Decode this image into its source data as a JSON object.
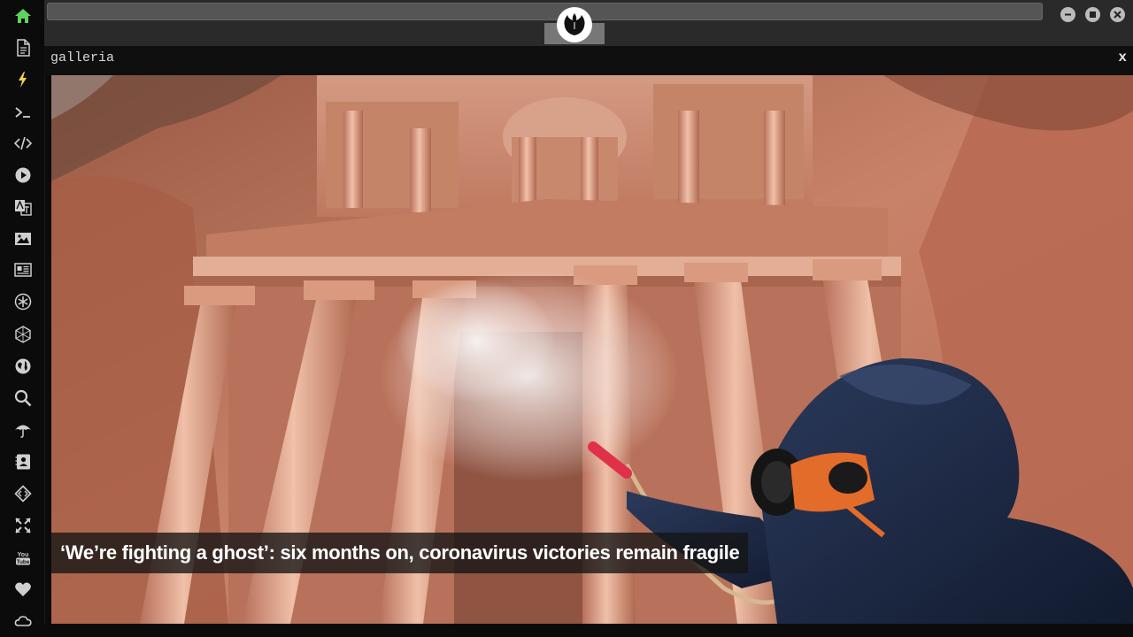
{
  "panel": {
    "title": "galleria",
    "close_label": "x"
  },
  "gallery": {
    "caption": "‘We’re fighting a ghost’: six months on, coronavirus victories remain fragile"
  },
  "sidebar": {
    "active_color": "#5fd35f",
    "icon_color": "#cfcfcf",
    "items": [
      {
        "icon": "home-icon",
        "active": true
      },
      {
        "icon": "document-icon"
      },
      {
        "icon": "lightning-icon"
      },
      {
        "icon": "terminal-icon"
      },
      {
        "icon": "code-icon"
      },
      {
        "icon": "play-icon"
      },
      {
        "icon": "translate-icon"
      },
      {
        "icon": "image-icon"
      },
      {
        "icon": "newspaper-icon"
      },
      {
        "icon": "asterisk-icon"
      },
      {
        "icon": "hexagon-icon"
      },
      {
        "icon": "globe-icon"
      },
      {
        "icon": "search-icon"
      },
      {
        "icon": "umbrella-icon"
      },
      {
        "icon": "contact-icon"
      },
      {
        "icon": "diamond-code-icon"
      },
      {
        "icon": "expand-icon"
      },
      {
        "icon": "youtube-icon"
      },
      {
        "icon": "heart-icon"
      },
      {
        "icon": "cloud-icon"
      }
    ]
  },
  "window": {
    "logo_icon": "rebel-alliance-icon",
    "controls": [
      "minimize-icon",
      "maximize-icon",
      "close-icon"
    ]
  }
}
